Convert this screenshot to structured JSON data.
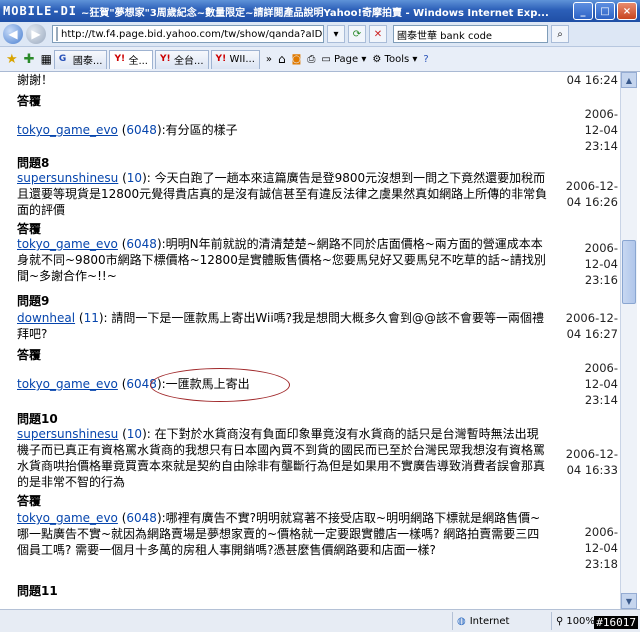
{
  "window": {
    "logo": "MOBILE-DI",
    "title": "~狂賀\"夢想家\"3周歲紀念~數量限定~請詳閱產品說明Yahoo!奇摩拍賣 - Windows Internet Exp...",
    "min": "_",
    "max": "□",
    "close": "×"
  },
  "address": {
    "url": "http://tw.f4.page.bid.yahoo.com/tw/show/qanda?aID=d22883888",
    "search_value": "國泰世華 bank code"
  },
  "tabs": [
    {
      "label": "國泰..."
    },
    {
      "label": "全..."
    },
    {
      "label": "全台..."
    },
    {
      "label": "WII..."
    }
  ],
  "toolbar": {
    "page": "Page",
    "tools": "Tools"
  },
  "qa": {
    "top_text": "謝謝！",
    "top_date": "04 16:24",
    "answer_label": "答覆",
    "q7_answer": {
      "user": "tokyo_game_evo",
      "rating": "6048",
      "text": ":有分區的樣子",
      "date1": "2006-",
      "date2": "12-04",
      "date3": "23:14"
    },
    "q8": {
      "head": "問題8",
      "user": "supersunshinesu",
      "rating": "10",
      "text": ": 今天白跑了一趟本來這篇廣告是登9800元沒想到一問之下竟然還要加稅而且還要等現貨是12800元覺得貴店真的是沒有誠信甚至有違反法律之虞果然真如網路上所傳的非常負面的評價",
      "date1": "2006-12-",
      "date2": "04 16:26"
    },
    "q8_answer": {
      "user": "tokyo_game_evo",
      "rating": "6048",
      "text": ":明明N年前就說的清清楚楚~網路不同於店面價格~兩方面的營運成本本身就不同~9800市網路下標價格~12800是實體販售價格~您要馬兒好又要馬兒不吃草的話~請找別間~多謝合作~!!~",
      "date1": "2006-",
      "date2": "12-04",
      "date3": "23:16"
    },
    "q9": {
      "head": "問題9",
      "user": "downheal",
      "rating": "11",
      "text": ": 請問一下是一匯款馬上寄出Wii嗎?我是想問大概多久會到@@該不會要等一兩個禮拜吧?",
      "date1": "2006-12-",
      "date2": "04 16:27"
    },
    "q9_answer": {
      "user": "tokyo_game_evo",
      "rating": "6048",
      "text": ":一匯款馬上寄出",
      "date1": "2006-",
      "date2": "12-04",
      "date3": "23:14"
    },
    "q10": {
      "head": "問題10",
      "user": "supersunshinesu",
      "rating": "10",
      "text": ": 在下對於水貨商沒有負面印象畢竟沒有水貨商的話只是台灣暫時無法出現機子而已真正有資格罵水貨商的我想只有日本國內買不到貨的國民而已至於台灣民眾我想沒有資格罵水貨商哄抬價格畢竟買賣本來就是契約自由除非有壟斷行為但是如果用不實廣告導致消費者誤會那真的是非常不智的行為",
      "date1": "2006-12-",
      "date2": "04 16:33"
    },
    "q10_answer": {
      "user": "tokyo_game_evo",
      "rating": "6048",
      "text": ":哪裡有廣告不實?明明就寫著不接受店取~明明網路下標就是網路售價~哪一點廣告不實~就因為網路賣場是夢想家賣的~價格就一定要跟實體店一樣嗎? 網路拍賣需要三四個員工嗎? 需要一個月十多萬的房租人事開銷嗎?憑甚麼售價網路要和店面一樣?",
      "date1": "2006-",
      "date2": "12-04",
      "date3": "23:18"
    },
    "q11": {
      "head": "問題11"
    }
  },
  "status": {
    "zone": "Internet",
    "zoom": "100%",
    "watermark": "#16017"
  }
}
